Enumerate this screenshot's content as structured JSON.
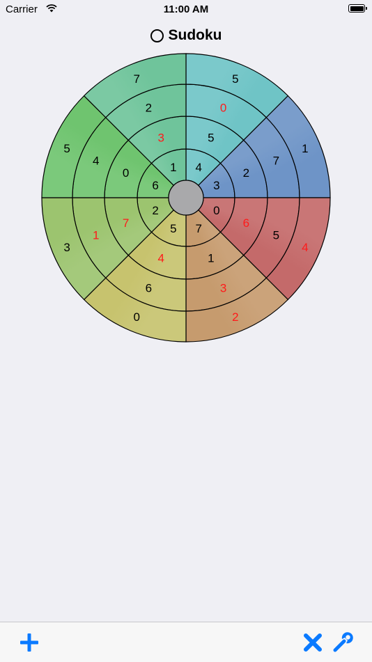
{
  "status_bar": {
    "carrier": "Carrier",
    "time": "11:00 AM"
  },
  "nav": {
    "title": "Sudoku"
  },
  "colors": {
    "accent": "#0a7aff",
    "given_digit": "#000000",
    "user_digit": "#ff1a1a"
  },
  "board": {
    "sectors": [
      {
        "base": "#6fc4c6",
        "values": [
          {
            "v": "4",
            "c": "black"
          },
          {
            "v": "5",
            "c": "black"
          },
          {
            "v": "0",
            "c": "red"
          },
          {
            "v": "5",
            "c": "black"
          }
        ]
      },
      {
        "base": "#6e94c7",
        "values": [
          {
            "v": "3",
            "c": "black"
          },
          {
            "v": "2",
            "c": "black"
          },
          {
            "v": "7",
            "c": "black"
          },
          {
            "v": "1",
            "c": "black"
          }
        ]
      },
      {
        "base": "#c46a6a",
        "values": [
          {
            "v": "0",
            "c": "black"
          },
          {
            "v": "6",
            "c": "red"
          },
          {
            "v": "5",
            "c": "black"
          },
          {
            "v": "4",
            "c": "red"
          }
        ]
      },
      {
        "base": "#c69b6e",
        "values": [
          {
            "v": "7",
            "c": "black"
          },
          {
            "v": "1",
            "c": "black"
          },
          {
            "v": "3",
            "c": "red"
          },
          {
            "v": "2",
            "c": "red"
          }
        ]
      },
      {
        "base": "#c7c36e",
        "values": [
          {
            "v": "5",
            "c": "black"
          },
          {
            "v": "4",
            "c": "red"
          },
          {
            "v": "6",
            "c": "black"
          },
          {
            "v": "0",
            "c": "black"
          }
        ]
      },
      {
        "base": "#9cc46f",
        "values": [
          {
            "v": "2",
            "c": "black"
          },
          {
            "v": "7",
            "c": "red"
          },
          {
            "v": "1",
            "c": "red"
          },
          {
            "v": "3",
            "c": "black"
          }
        ]
      },
      {
        "base": "#6fc46f",
        "values": [
          {
            "v": "6",
            "c": "black"
          },
          {
            "v": "0",
            "c": "black"
          },
          {
            "v": "4",
            "c": "black"
          },
          {
            "v": "5",
            "c": "black"
          }
        ]
      },
      {
        "base": "#6fc49b",
        "values": [
          {
            "v": "1",
            "c": "black"
          },
          {
            "v": "3",
            "c": "red"
          },
          {
            "v": "2",
            "c": "black"
          },
          {
            "v": "7",
            "c": "black"
          }
        ]
      }
    ]
  },
  "toolbar": {
    "add_icon": "plus-icon",
    "clear_icon": "x-icon",
    "settings_icon": "wrench-icon"
  }
}
